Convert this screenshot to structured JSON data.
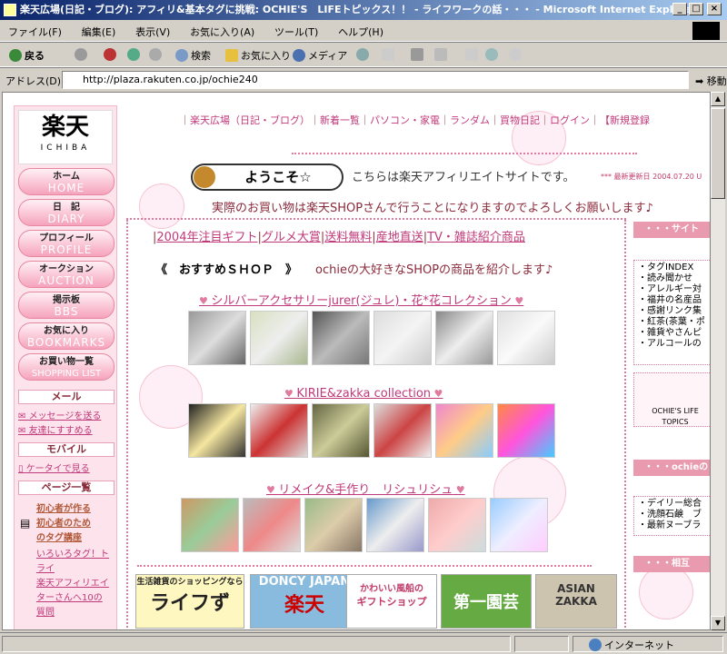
{
  "window": {
    "title": "楽天広場(日記・ブログ): アフィリ&基本タグに挑戦: OCHIE'S　LIFEトピックス！！ - ライフワークの話・・・ - Microsoft Internet Explorer",
    "minimize": "_",
    "maximize": "□",
    "close": "×"
  },
  "menu": [
    "ファイル(F)",
    "編集(E)",
    "表示(V)",
    "お気に入り(A)",
    "ツール(T)",
    "ヘルプ(H)"
  ],
  "toolbar": {
    "back": "戻る",
    "search": "検索",
    "favorites": "お気に入り",
    "media": "メディア"
  },
  "address": {
    "label": "アドレス(D)",
    "url": "http://plaza.rakuten.co.jp/ochie240",
    "go": "移動"
  },
  "status": {
    "zone": "インターネット"
  },
  "sidebar": {
    "logo_main": "楽天",
    "logo_sub": "ICHIBA",
    "nav": [
      {
        "jp": "ホーム",
        "en": "HOME"
      },
      {
        "jp": "日　記",
        "en": "DIARY"
      },
      {
        "jp": "プロフィール",
        "en": "PROFILE"
      },
      {
        "jp": "オークション",
        "en": "AUCTION"
      },
      {
        "jp": "掲示板",
        "en": "BBS"
      },
      {
        "jp": "お気に入り",
        "en": "BOOKMARKS"
      },
      {
        "jp": "お買い物一覧",
        "en": "SHOPPING LIST"
      }
    ],
    "mail_header": "メール",
    "mail_links": [
      "メッセージを送る",
      "友達にすすめる"
    ],
    "mobile_header": "モバイル",
    "mobile_link": "ケータイで見る",
    "pages_header": "ページ一覧",
    "page_title1": "初心者が作る",
    "page_title2": "初心者のため",
    "page_title3": "のタグ講座",
    "page_links": [
      "いろいろタグ！ト",
      "ライ",
      "楽天アフィリエイ",
      "ターさんへ10の",
      "質問"
    ]
  },
  "topnav": {
    "items": [
      "楽天広場（日記・ブログ）",
      "新着一覧",
      "パソコン・家電",
      "ランダム",
      "買物日記",
      "ログイン",
      "【新規登録"
    ]
  },
  "welcome": {
    "badge": "ようこそ☆",
    "line1": "こちらは楽天アフィリエイトサイトです。",
    "updated": "*** 最新更新日 2004.07.20 U",
    "line2": "実際のお買い物は楽天SHOPさんで行うことになりますのでよろしくお願いします♪"
  },
  "categories": [
    "2004年注目ギフト",
    "グルメ大賞",
    "送料無料",
    "産地直送",
    "TV・雑誌紹介商品"
  ],
  "recommend": {
    "label": "《　おすすめＳＨＯＰ　》",
    "desc": "ochieの大好きなSHOPの商品を紹介します♪"
  },
  "sections": [
    {
      "title": "シルバーアクセサリーjurer(ジュレ)・花*花コレクション"
    },
    {
      "title": "KIRIE&zakka collection"
    },
    {
      "title": "リメイク&手作り　リシュリシュ"
    }
  ],
  "banners": [
    {
      "line1": "生活雑貨のショッピングなら",
      "line2": "ライフず"
    },
    {
      "line1": "DONCY JAPAN",
      "line2": "楽天"
    },
    {
      "line1": "かわいい風船の",
      "line2": "ギフトショップ"
    },
    {
      "line1": "",
      "line2": "第一園芸"
    },
    {
      "line1": "ASIAN",
      "line2": "ZAKKA"
    }
  ],
  "right": {
    "site_header": "・・・サイト",
    "site_links": [
      "・タグINDEX",
      "・読み聞かせ",
      "・アレルギー対",
      "・福井の名産品",
      "・感謝リンク集",
      "・紅茶(茶葉・ポ",
      "・雑貨やさんピ",
      "・アルコールの"
    ],
    "topics_label": "OCHIE'S LIFE TOPICS",
    "ochie_header": "・・・ochieの",
    "ochie_links": [
      "・デイリー総合",
      "・洗顔石鹸　ブ",
      "・最新ヌーブラ"
    ],
    "third_header": "・・・相互"
  }
}
